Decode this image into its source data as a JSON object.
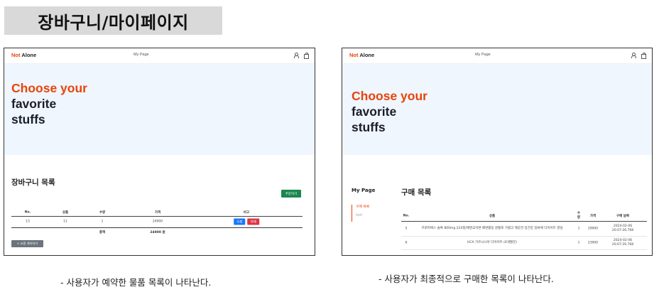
{
  "page_title": "장바구니/마이페이지",
  "brand": {
    "part1": "Not",
    "part2": "Alone"
  },
  "nav_link": "My Page",
  "hero": {
    "line1": "Choose your",
    "line2": "favorite",
    "line3": "stuffs"
  },
  "cart": {
    "title": "장바구니 목록",
    "order_button": "주문하기",
    "headers": [
      "No.",
      "상품",
      "수량",
      "가격",
      "비고"
    ],
    "rows": [
      {
        "no": "13",
        "product": "11",
        "qty": "1",
        "price": "24900",
        "edit": "수정",
        "delete": "삭제"
      }
    ],
    "total_label": "총액",
    "total_value": "24900 원",
    "continue_button": "+ 쇼핑 계속하기"
  },
  "mypage": {
    "side_title": "My Page",
    "side_items": [
      "구매 목록",
      "test"
    ],
    "title": "구매 목록",
    "headers": [
      "No.",
      "상품",
      "수량",
      "가격",
      "구매 날짜"
    ],
    "rows": [
      {
        "no": "5",
        "product": "프로피에스 슬록 800mg 224정/해변교석변 배변활동 원활로 가볍고 깨끗한 장건강 일류에 다이어트 영실",
        "qty": "1",
        "price": "29900",
        "date": "2024-02-06 20:07:26.768"
      },
      {
        "no": "6",
        "product": "HCA 가르시니아 다이어트 (6개월분)",
        "qty": "1",
        "price": "23900",
        "date": "2024-02-06 20:07:26.768"
      }
    ]
  },
  "captions": {
    "left": "- 사용자가 예약한 물품 목록이 나타난다.",
    "right": "- 사용자가 최종적으로 구매한 목록이 나타난다."
  },
  "colors": {
    "brand_orange": "#e8440a",
    "hero_bg": "#eff6fd",
    "order_green": "#19874f",
    "edit_blue": "#1677ff",
    "delete_red": "#dc3545"
  }
}
